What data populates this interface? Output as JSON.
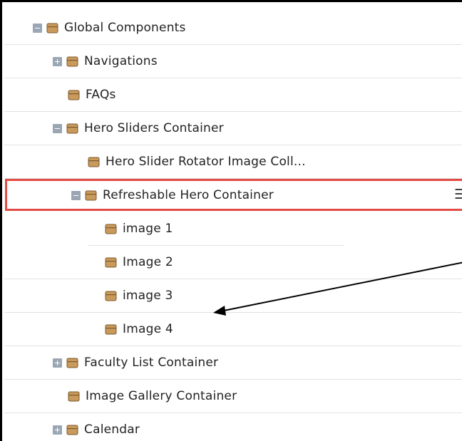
{
  "tree": {
    "items": [
      {
        "label": "Global Components",
        "toggle": "minus"
      },
      {
        "label": "Navigations",
        "toggle": "plus"
      },
      {
        "label": "FAQs",
        "toggle": "none"
      },
      {
        "label": "Hero Sliders Container",
        "toggle": "minus"
      },
      {
        "label": "Hero Slider Rotator Image Coll...",
        "toggle": "none"
      },
      {
        "label": "Refreshable Hero Container",
        "toggle": "minus"
      },
      {
        "label": "image 1",
        "toggle": "none"
      },
      {
        "label": "Image 2",
        "toggle": "none"
      },
      {
        "label": "image 3",
        "toggle": "none"
      },
      {
        "label": "Image 4",
        "toggle": "none"
      },
      {
        "label": "Faculty List Container",
        "toggle": "plus"
      },
      {
        "label": "Image Gallery Container",
        "toggle": "none"
      },
      {
        "label": "Calendar",
        "toggle": "plus"
      }
    ],
    "selected_item": "Refreshable Hero Container",
    "menu_icon": "hamburger-dropdown-icon"
  },
  "annotation": {
    "highlight_color": "#e24b43",
    "arrow_color": "#000000",
    "arrow_icon": "arrow-pointer-icon"
  },
  "colors": {
    "folder_fill": "#c99a5b",
    "folder_stroke": "#7a5a2e",
    "toggle_fill": "#9aa6b3"
  }
}
